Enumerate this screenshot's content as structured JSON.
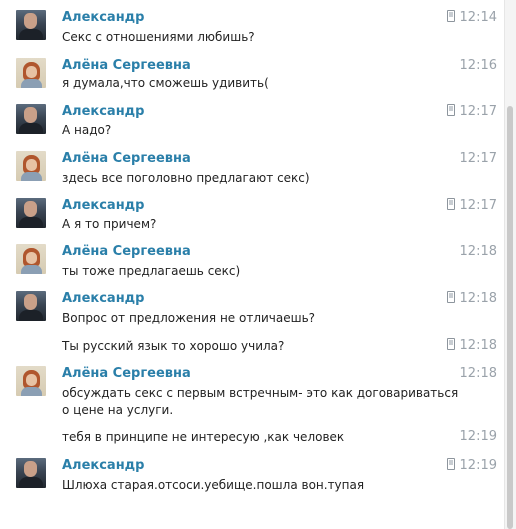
{
  "messages": [
    {
      "sender": "Александр",
      "avatar": "male",
      "time": "12:14",
      "phone": true,
      "lines": [
        "Секс с отношениями любишь?"
      ]
    },
    {
      "sender": "Алёна Сергеевна",
      "avatar": "female",
      "time": "12:16",
      "phone": false,
      "lines": [
        "я думала,что сможешь удивить("
      ]
    },
    {
      "sender": "Александр",
      "avatar": "male",
      "time": "12:17",
      "phone": true,
      "lines": [
        "А надо?"
      ]
    },
    {
      "sender": "Алёна Сергеевна",
      "avatar": "female",
      "time": "12:17",
      "phone": false,
      "lines": [
        "здесь все поголовно предлагают секс)"
      ]
    },
    {
      "sender": "Александр",
      "avatar": "male",
      "time": "12:17",
      "phone": true,
      "lines": [
        "А я то причем?"
      ]
    },
    {
      "sender": "Алёна Сергеевна",
      "avatar": "female",
      "time": "12:18",
      "phone": false,
      "lines": [
        "ты тоже предлагаешь секс)"
      ]
    },
    {
      "sender": "Александр",
      "avatar": "male",
      "time": "12:18",
      "phone": true,
      "lines": [
        "Вопрос от предложения не отличаешь?"
      ]
    },
    {
      "sender": "",
      "avatar": "",
      "time": "12:18",
      "phone": true,
      "lines": [
        "Ты русский язык то хорошо учила?"
      ]
    },
    {
      "sender": "Алёна Сергеевна",
      "avatar": "female",
      "time": "12:18",
      "phone": false,
      "lines": [
        "обсуждать секс с первым встречным- это как договариваться\nо цене на услуги."
      ]
    },
    {
      "sender": "",
      "avatar": "",
      "time": "12:19",
      "phone": false,
      "lines": [
        "тебя в принципе не интересую ,как человек"
      ]
    },
    {
      "sender": "Александр",
      "avatar": "male",
      "time": "12:19",
      "phone": true,
      "lines": [
        "Шлюха старая.отсоси.уебище.пошла вон.тупая"
      ]
    }
  ]
}
